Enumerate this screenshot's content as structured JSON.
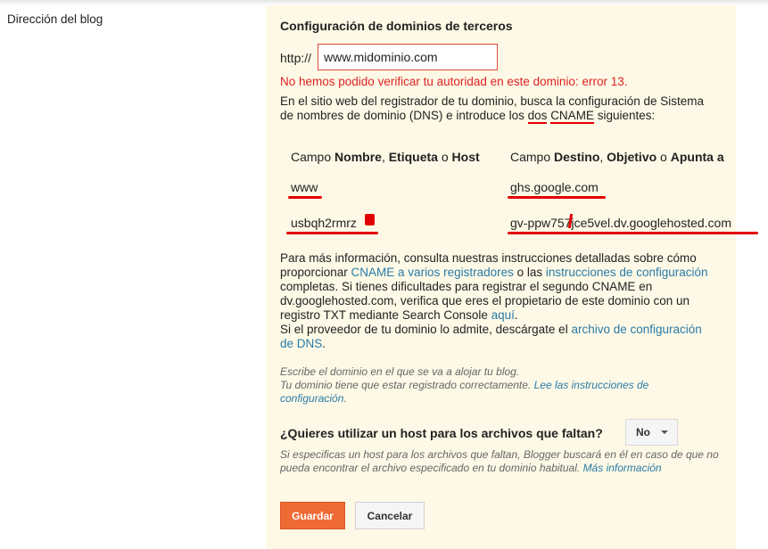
{
  "left_label": "Dirección del blog",
  "title": "Configuración de dominios de terceros",
  "http_prefix": "http://",
  "domain_value": "www.midominio.com",
  "error": "No hemos podido verificar tu autoridad en este dominio: error 13.",
  "intro": {
    "part1": "En el sitio web del registrador de tu dominio, busca la configuración de Sistema de nombres de dominio (DNS) e introduce los ",
    "dos": "dos",
    "space": " ",
    "cname": "CNAME",
    "part2": " siguientes:"
  },
  "table": {
    "h1_pre": "Campo ",
    "h1_b1": "Nombre",
    "h1_sep1": ", ",
    "h1_b2": "Etiqueta",
    "h1_sep2": " o ",
    "h1_b3": "Host",
    "h2_pre": "Campo ",
    "h2_b1": "Destino",
    "h2_sep1": ", ",
    "h2_b2": "Objetivo",
    "h2_sep2": " o ",
    "h2_b3": "Apunta a",
    "rows": [
      {
        "name": "www",
        "target": "ghs.google.com"
      },
      {
        "name": "usbqh2rmrz",
        "target": "gv-ppw757jce5vel.dv.googlehosted.com"
      }
    ]
  },
  "info": {
    "t1": "Para más información, consulta nuestras instrucciones detalladas sobre cómo proporcionar ",
    "l1": "CNAME a varios registradores",
    "t2": " o las ",
    "l2": "instrucciones de configuración",
    "t3": " completas. Si tienes dificultades para registrar el segundo CNAME en dv.googlehosted.com, verifica que eres el propietario de este dominio con un registro TXT mediante Search Console ",
    "l3": "aquí",
    "t4": ".",
    "t5": "Si el proveedor de tu dominio lo admite, descárgate el ",
    "l4": "archivo de configuración de DNS",
    "t6": "."
  },
  "note": {
    "line1": "Escribe el dominio en el que se va a alojar tu blog.",
    "line2": "Tu dominio tiene que estar registrado correctamente. ",
    "link": "Lee las instrucciones de configuración",
    "end": "."
  },
  "question": "¿Quieres utilizar un host para los archivos que faltan?",
  "select_value": "No",
  "note2": {
    "text": "Si especificas un host para los archivos que faltan, Blogger buscará en él en caso de que no pueda encontrar el archivo especificado en tu dominio habitual. ",
    "link": "Más información"
  },
  "buttons": {
    "save": "Guardar",
    "cancel": "Cancelar"
  },
  "colors": {
    "accent": "#f06a35",
    "link": "#2a7aa8",
    "error": "#dd2222",
    "panel": "#fdf9e6",
    "annotation": "#e00000"
  }
}
